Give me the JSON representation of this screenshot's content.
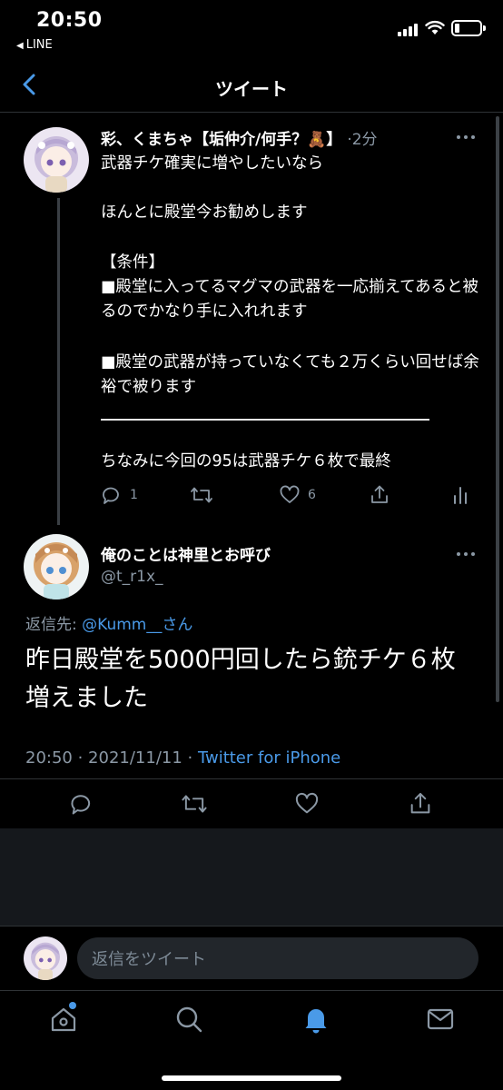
{
  "status_bar": {
    "time": "20:50",
    "back_app_label": "LINE"
  },
  "header": {
    "title": "ツイート"
  },
  "parent_tweet": {
    "display_name": "彩、くまちゃ【垢仲介/何手？🧸】",
    "time_sep": "·",
    "time_ago": "2分",
    "text_blocks": [
      "武器チケ確実に増やしたいなら",
      "ほんとに殿堂今お勧めします",
      "【条件】\n■殿堂に入ってるマグマの武器を一応揃えてあると被るのでかなり手に入れれます",
      "■殿堂の武器が持っていなくても２万くらい回せば余裕で被ります",
      "ちなみに今回の95は武器チケ６枚で最終"
    ],
    "reply_count": "1",
    "like_count": "6"
  },
  "main_tweet": {
    "display_name": "俺のことは神里とお呼び",
    "handle": "@t_r1x_",
    "reply_to_label": "返信先: ",
    "reply_to_mention": "@Kumm__さん",
    "text": "昨日殿堂を5000円回したら銃チケ６枚増えました",
    "timestamp": "20:50 · 2021/11/11 · ",
    "source": "Twitter for iPhone"
  },
  "composer": {
    "placeholder": "返信をツイート"
  },
  "tabbar": {
    "icons": [
      "home-icon",
      "search-icon",
      "notifications-icon",
      "messages-icon"
    ],
    "active": "notifications-icon"
  },
  "colors": {
    "background": "#000000",
    "accent": "#4a9ae8",
    "secondary_text": "#8b98a5"
  }
}
